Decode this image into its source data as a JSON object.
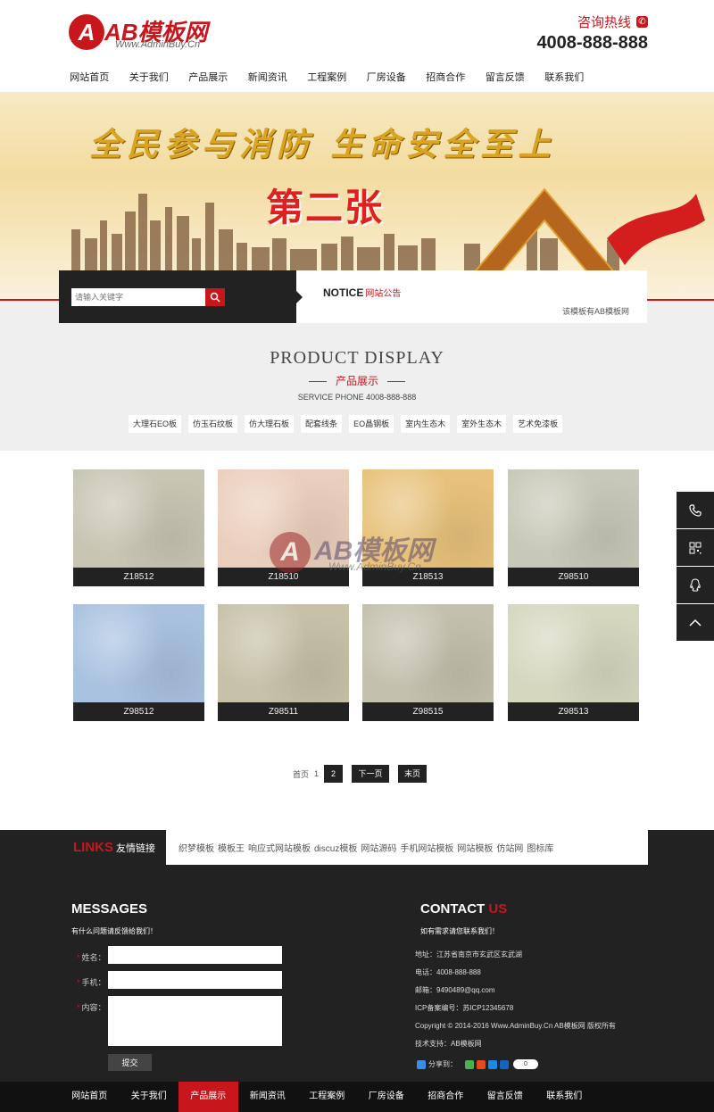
{
  "header": {
    "logo_letter": "A",
    "logo_name": "AB模板网",
    "logo_sub": "Www.AdminBuy.Cn",
    "hotline_label": "咨询热线",
    "hotline_number": "4008-888-888"
  },
  "nav": [
    "网站首页",
    "关于我们",
    "产品展示",
    "新闻资讯",
    "工程案例",
    "厂房设备",
    "招商合作",
    "留言反馈",
    "联系我们"
  ],
  "banner": {
    "slogan": "全民参与消防 生命安全至上",
    "big_text": "第二张"
  },
  "search": {
    "placeholder": "请输入关键字"
  },
  "notice": {
    "title_en": "NOTICE",
    "title_cn": "网站公告",
    "item": "该模板有AB模板网"
  },
  "products_section": {
    "title_en": "PRODUCT DISPLAY",
    "title_cn": "产品展示",
    "phone": "SERVICE PHONE 4008-888-888",
    "categories": [
      "大理石EO板",
      "仿玉石纹板",
      "仿大理石板",
      "配套线条",
      "EO晶钢板",
      "室内生态木",
      "室外生态木",
      "艺术免漆板"
    ]
  },
  "products": [
    {
      "code": "Z18512",
      "color": "#c9c5b3"
    },
    {
      "code": "Z18510",
      "color": "#ebcfbd"
    },
    {
      "code": "Z18513",
      "color": "#e8c27c"
    },
    {
      "code": "Z98510",
      "color": "#c8c8b8"
    },
    {
      "code": "Z98512",
      "color": "#a9c2e0"
    },
    {
      "code": "Z98511",
      "color": "#c7c1a8"
    },
    {
      "code": "Z98515",
      "color": "#c3c1ad"
    },
    {
      "code": "Z98513",
      "color": "#d6d7bf"
    }
  ],
  "watermark": {
    "letter": "A",
    "name": "AB模板网",
    "sub": "Www.AdminBuy.Cn"
  },
  "pagination": {
    "first": "首页",
    "page1": "1",
    "page2": "2",
    "next": "下一页",
    "last": "末页"
  },
  "links": {
    "label_en": "LINKS",
    "label_cn": "友情链接",
    "items": [
      "织梦模板",
      "模板王",
      "响应式网站模板",
      "discuz模板",
      "网站源码",
      "手机网站模板",
      "网站模板",
      "仿站网",
      "图标库"
    ]
  },
  "messages": {
    "title": "MESSAGES",
    "subtitle": "有什么问题请反馈给我们！",
    "name_label": "姓名：",
    "phone_label": "手机：",
    "content_label": "内容：",
    "required_mark": "*",
    "submit": "提交"
  },
  "contact": {
    "title_main": "CONTACT",
    "title_accent": "US",
    "subtitle": "如有需求请您联系我们！",
    "address": "地址：江苏省南京市玄武区玄武湖",
    "phone": "电话：4008-888-888",
    "email": "邮箱：9490489@qq.com",
    "icp": "ICP备案编号：苏ICP12345678",
    "copyright": "Copyright © 2014-2016 Www.AdminBuy.Cn AB模板网 版权所有",
    "support": "技术支持：AB模板网",
    "share_label": "分享到：",
    "share_count": "0"
  },
  "bottom_nav": {
    "items": [
      "网站首页",
      "关于我们",
      "产品展示",
      "新闻资讯",
      "工程案例",
      "厂房设备",
      "招商合作",
      "留言反馈",
      "联系我们"
    ],
    "active": "产品展示"
  },
  "side_tools": [
    "phone-icon",
    "qrcode-icon",
    "qq-icon",
    "back-to-top-icon"
  ],
  "colors": {
    "accent": "#c8161d",
    "dark": "#222222"
  }
}
